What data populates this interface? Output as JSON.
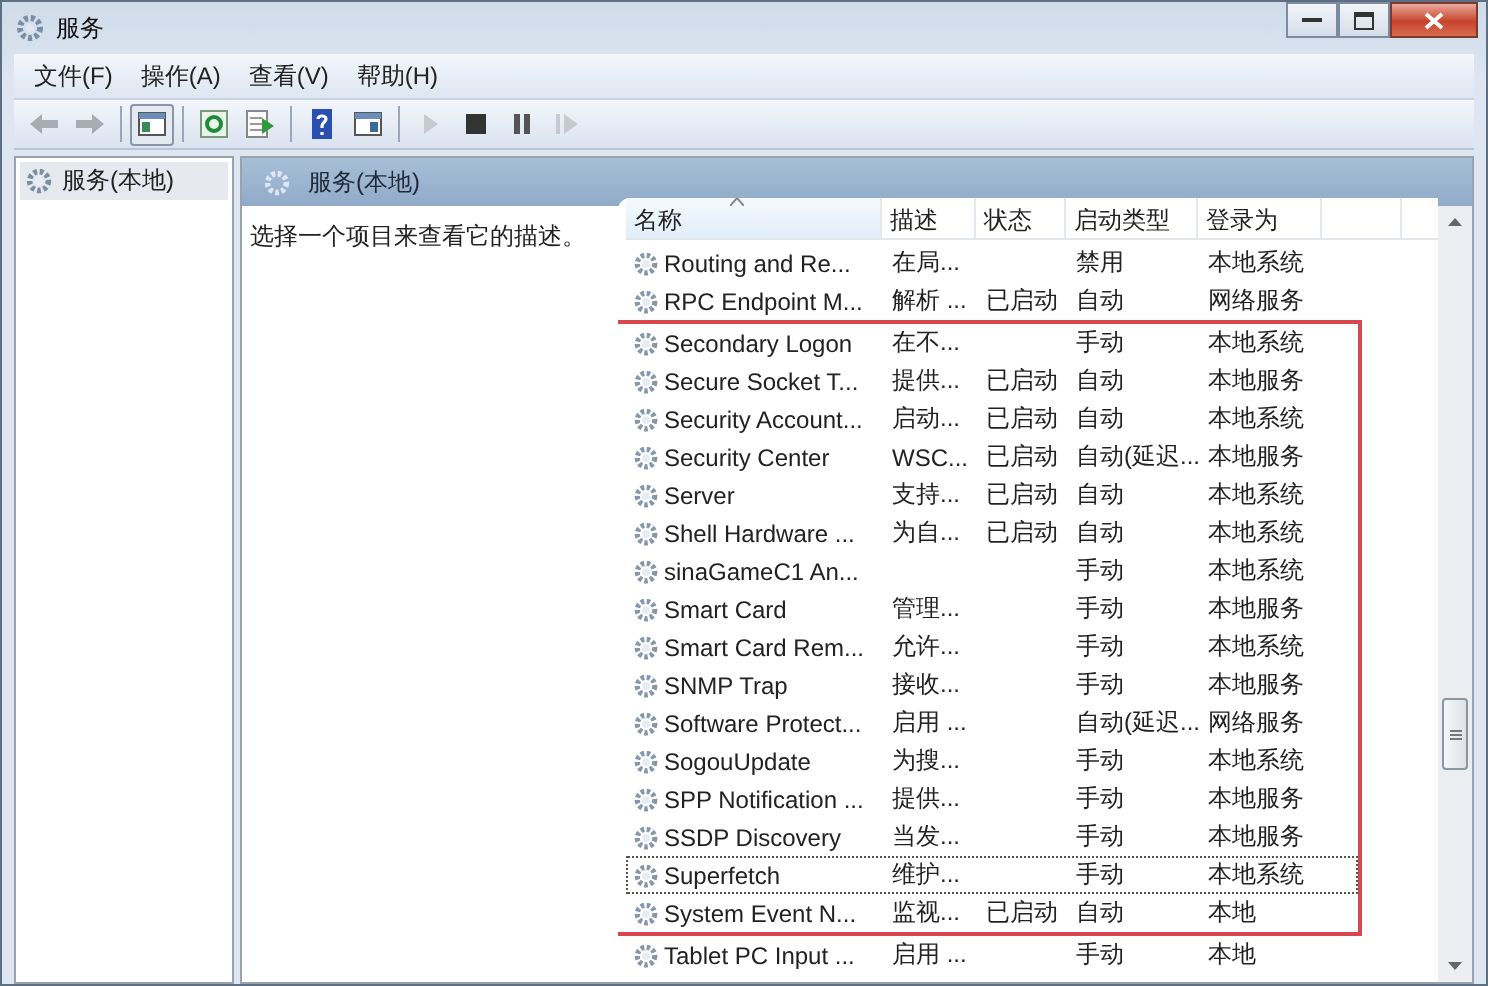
{
  "window": {
    "title": "服务"
  },
  "menu": [
    {
      "label": "文件(F)"
    },
    {
      "label": "操作(A)"
    },
    {
      "label": "查看(V)"
    },
    {
      "label": "帮助(H)"
    }
  ],
  "toolbar": [
    {
      "kind": "back",
      "disabled": true
    },
    {
      "kind": "forward",
      "disabled": true
    },
    {
      "kind": "sep"
    },
    {
      "kind": "tree"
    },
    {
      "kind": "sep"
    },
    {
      "kind": "refresh"
    },
    {
      "kind": "export"
    },
    {
      "kind": "sep"
    },
    {
      "kind": "help"
    },
    {
      "kind": "view"
    },
    {
      "kind": "sep"
    },
    {
      "kind": "play",
      "disabled": true
    },
    {
      "kind": "stop",
      "disabled": false
    },
    {
      "kind": "pause",
      "disabled": false
    },
    {
      "kind": "resume",
      "disabled": true
    }
  ],
  "tree": [
    {
      "label": "服务(本地)",
      "selected": true
    }
  ],
  "panel": {
    "title": "服务(本地)",
    "description": "选择一个项目来查看它的描述。"
  },
  "columns": [
    {
      "label": "名称",
      "sorted": true
    },
    {
      "label": "描述",
      "sorted": false
    },
    {
      "label": "状态",
      "sorted": false
    },
    {
      "label": "启动类型",
      "sorted": false
    },
    {
      "label": "登录为",
      "sorted": false
    }
  ],
  "rows": [
    {
      "name": "Routing and Re...",
      "description": "在局...",
      "status": "",
      "startup": "禁用",
      "logon": "本地系统",
      "focused": false,
      "highlighted": false
    },
    {
      "name": "RPC Endpoint M...",
      "description": "解析 ...",
      "status": "已启动",
      "startup": "自动",
      "logon": "网络服务",
      "focused": false,
      "highlighted": false
    },
    {
      "name": "Secondary Logon",
      "description": "在不...",
      "status": "",
      "startup": "手动",
      "logon": "本地系统",
      "focused": false,
      "highlighted": true
    },
    {
      "name": "Secure Socket T...",
      "description": "提供...",
      "status": "已启动",
      "startup": "自动",
      "logon": "本地服务",
      "focused": false,
      "highlighted": true
    },
    {
      "name": "Security Account...",
      "description": "启动...",
      "status": "已启动",
      "startup": "自动",
      "logon": "本地系统",
      "focused": false,
      "highlighted": true
    },
    {
      "name": "Security Center",
      "description": "WSC...",
      "status": "已启动",
      "startup": "自动(延迟...",
      "logon": "本地服务",
      "focused": false,
      "highlighted": true
    },
    {
      "name": "Server",
      "description": "支持...",
      "status": "已启动",
      "startup": "自动",
      "logon": "本地系统",
      "focused": false,
      "highlighted": true
    },
    {
      "name": "Shell Hardware ...",
      "description": "为自...",
      "status": "已启动",
      "startup": "自动",
      "logon": "本地系统",
      "focused": false,
      "highlighted": true
    },
    {
      "name": "sinaGameC1 An...",
      "description": "",
      "status": "",
      "startup": "手动",
      "logon": "本地系统",
      "focused": false,
      "highlighted": true
    },
    {
      "name": "Smart Card",
      "description": "管理...",
      "status": "",
      "startup": "手动",
      "logon": "本地服务",
      "focused": false,
      "highlighted": true
    },
    {
      "name": "Smart Card Rem...",
      "description": "允许...",
      "status": "",
      "startup": "手动",
      "logon": "本地系统",
      "focused": false,
      "highlighted": true
    },
    {
      "name": "SNMP Trap",
      "description": "接收...",
      "status": "",
      "startup": "手动",
      "logon": "本地服务",
      "focused": false,
      "highlighted": true
    },
    {
      "name": "Software Protect...",
      "description": "启用 ...",
      "status": "",
      "startup": "自动(延迟...",
      "logon": "网络服务",
      "focused": false,
      "highlighted": true
    },
    {
      "name": "SogouUpdate",
      "description": "为搜...",
      "status": "",
      "startup": "手动",
      "logon": "本地系统",
      "focused": false,
      "highlighted": true
    },
    {
      "name": "SPP Notification ...",
      "description": "提供...",
      "status": "",
      "startup": "手动",
      "logon": "本地服务",
      "focused": false,
      "highlighted": true
    },
    {
      "name": "SSDP Discovery",
      "description": "当发...",
      "status": "",
      "startup": "手动",
      "logon": "本地服务",
      "focused": false,
      "highlighted": true
    },
    {
      "name": "Superfetch",
      "description": "维护...",
      "status": "",
      "startup": "手动",
      "logon": "本地系统",
      "focused": true,
      "highlighted": true
    },
    {
      "name": "System Event N...",
      "description": "监视...",
      "status": "已启动",
      "startup": "自动",
      "logon": "本地",
      "focused": false,
      "highlighted": true
    },
    {
      "name": "Tablet PC Input ...",
      "description": "启用 ...",
      "status": "",
      "startup": "手动",
      "logon": "本地",
      "focused": false,
      "highlighted": false
    }
  ]
}
